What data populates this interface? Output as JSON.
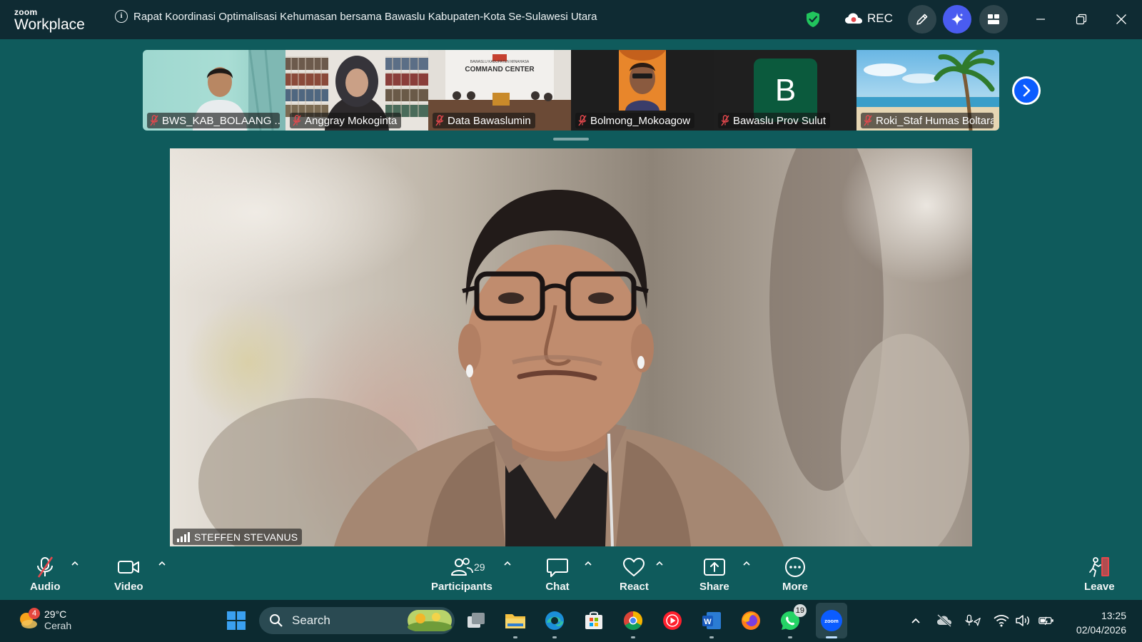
{
  "app": {
    "brand_small": "zoom",
    "brand_large": "Workplace"
  },
  "meeting": {
    "title": "Rapat Koordinasi Optimalisasi Kehumasan bersama Bawaslu Kabupaten-Kota Se-Sulawesi Utara",
    "rec_label": "REC"
  },
  "thumbnails": [
    {
      "name": "BWS_KAB_BOLAANG ...",
      "muted": true
    },
    {
      "name": "Anggray Mokoginta",
      "muted": true
    },
    {
      "name": "Data Bawaslumin",
      "muted": true,
      "video_caption": "COMMAND CENTER",
      "video_sub": "BAWASLU KABUPATEN MINAHASA"
    },
    {
      "name": "Bolmong_Mokoagow",
      "muted": true
    },
    {
      "name": "Bawaslu Prov Sulut",
      "muted": true,
      "avatar_letter": "B"
    },
    {
      "name": "Roki_Staf Humas Boltara",
      "muted": true
    }
  ],
  "speaker": {
    "name": "STEFFEN STEVANUS"
  },
  "toolbar": {
    "audio": "Audio",
    "video": "Video",
    "participants": "Participants",
    "participants_count": "29",
    "chat": "Chat",
    "react": "React",
    "share": "Share",
    "more": "More",
    "leave": "Leave"
  },
  "taskbar": {
    "weather_temp": "29°C",
    "weather_desc": "Cerah",
    "weather_badge": "4",
    "search_placeholder": "Search",
    "whatsapp_badge": "19",
    "time": "13:25",
    "date": "02/04/2026"
  },
  "colors": {
    "meeting_bg": "#0f5b5c",
    "titlebar_bg": "#0f2b33",
    "taskbar_bg": "#0c2a30",
    "accent_blue": "#0b5cff",
    "mute_red": "#e5484d",
    "rec_red": "#e5484d",
    "leave_red": "#e5484d"
  }
}
